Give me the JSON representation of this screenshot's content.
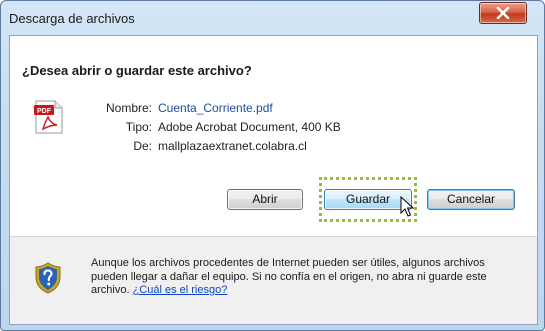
{
  "window": {
    "title": "Descarga de archivos"
  },
  "dialog": {
    "question": "¿Desea abrir o guardar este archivo?",
    "file": {
      "name_label": "Nombre:",
      "name_value": "Cuenta_Corriente.pdf",
      "type_label": "Tipo:",
      "type_value": "Adobe Acrobat Document, 400 KB",
      "from_label": "De:",
      "from_value": "mallplazaextranet.colabra.cl"
    },
    "icon_label": "PDF",
    "buttons": {
      "open": "Abrir",
      "save": "Guardar",
      "cancel": "Cancelar"
    },
    "warning": {
      "text": "Aunque los archivos procedentes de Internet pueden ser útiles, algunos archivos pueden llegar a dañar el equipo. Si no confía en el origen, no abra ni guarde este archivo. ",
      "link": "¿Cuál es el riesgo?"
    }
  },
  "icons": {
    "file": "pdf-file-icon",
    "security": "shield-question-icon",
    "close": "close-icon",
    "pointer": "mouse-pointer-icon"
  }
}
